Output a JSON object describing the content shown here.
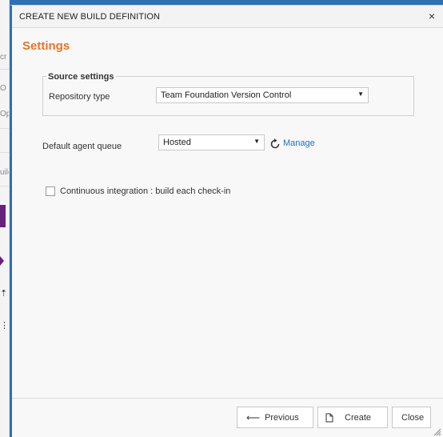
{
  "background": {
    "fragments": [
      "cr",
      "O",
      "Op",
      "uilc"
    ]
  },
  "dialog": {
    "title": "CREATE NEW BUILD DEFINITION",
    "close_glyph": "×",
    "heading": "Settings",
    "source_settings": {
      "legend": "Source settings",
      "repository_type_label": "Repository type",
      "repository_type_value": "Team Foundation Version Control"
    },
    "agent_queue": {
      "label": "Default agent queue",
      "value": "Hosted",
      "manage_label": "Manage"
    },
    "ci": {
      "label": "Continuous integration : build each check-in",
      "checked": false
    },
    "footer": {
      "previous_label": "Previous",
      "create_label": "Create",
      "close_label": "Close"
    }
  },
  "colors": {
    "accent": "#2f6fb3",
    "heading": "#e7752a",
    "link": "#1f6fbf"
  }
}
